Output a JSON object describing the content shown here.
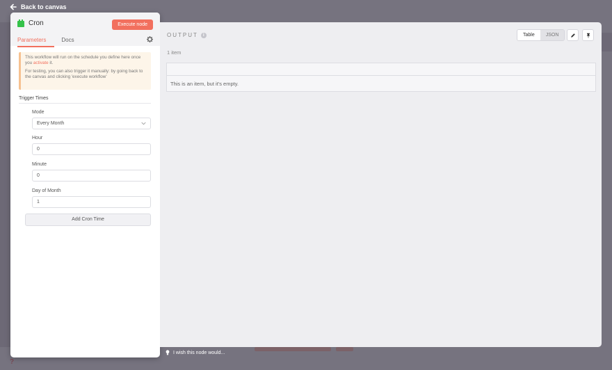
{
  "top": {
    "back_label": "Back to canvas"
  },
  "node": {
    "title": "Cron",
    "execute_label": "Execute node",
    "tabs": [
      {
        "label": "Parameters",
        "active": true
      },
      {
        "label": "Docs",
        "active": false
      }
    ]
  },
  "notice": {
    "text1_before": "This workflow will run on the schedule you define here once you ",
    "text1_link": "activate",
    "text1_after": " it.",
    "text2": "For testing, you can also trigger it manually: by going back to the canvas and clicking 'execute workflow'"
  },
  "trigger": {
    "section_title": "Trigger Times",
    "fields": {
      "mode": {
        "label": "Mode",
        "value": "Every Month"
      },
      "hour": {
        "label": "Hour",
        "value": "0"
      },
      "minute": {
        "label": "Minute",
        "value": "0"
      },
      "day": {
        "label": "Day of Month",
        "value": "1"
      }
    },
    "add_label": "Add Cron Time"
  },
  "output": {
    "title": "OUTPUT",
    "view_options": [
      "Table",
      "JSON"
    ],
    "selected_view": "Table",
    "item_count": "1 item",
    "empty_message": "This is an item, but it's empty."
  },
  "feedback": {
    "label": "I wish this node would..."
  },
  "colors": {
    "accent": "#f2705e",
    "backdrop": "#76737f",
    "node_icon": "#35c24a",
    "notice_bg": "#fdf5e9"
  }
}
